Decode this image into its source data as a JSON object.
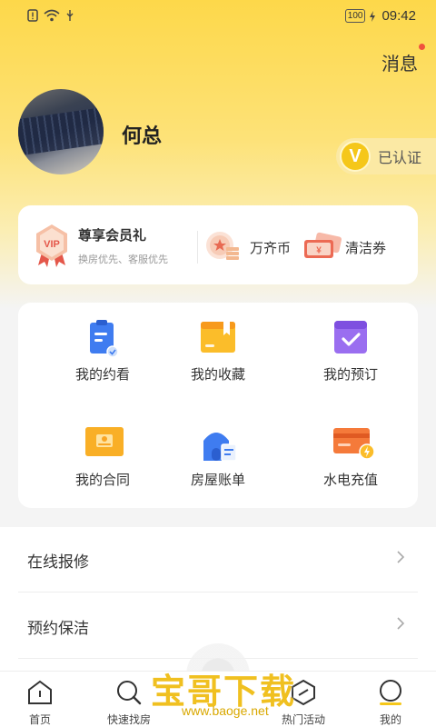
{
  "statusbar": {
    "battery": "100",
    "time": "09:42"
  },
  "header": {
    "messages_label": "消息",
    "user_name": "何总",
    "verified_badge": "V",
    "verified_label": "已认证"
  },
  "member": {
    "vip_text": "VIP",
    "title": "尊享会员礼",
    "subtitle": "换房优先、客服优先",
    "coins_label": "万齐币",
    "coupon_mark": "¥",
    "coupon_label": "清洁券"
  },
  "grid": [
    {
      "label": "我的约看",
      "icon": "appointment-icon"
    },
    {
      "label": "我的收藏",
      "icon": "favorites-icon"
    },
    {
      "label": "我的预订",
      "icon": "booking-icon"
    },
    {
      "label": "我的合同",
      "icon": "contract-icon"
    },
    {
      "label": "房屋账单",
      "icon": "bill-icon"
    },
    {
      "label": "水电充值",
      "icon": "recharge-icon"
    }
  ],
  "list": [
    {
      "label": "在线报修"
    },
    {
      "label": "预约保洁"
    }
  ],
  "tabs": [
    {
      "label": "首页"
    },
    {
      "label": "快速找房"
    },
    {
      "label": "热门活动"
    },
    {
      "label": "我的"
    }
  ],
  "watermark": {
    "text": "宝哥下载",
    "url": "www.baoge.net"
  },
  "colors": {
    "accent": "#f5c71a",
    "hero": "#fdd84a",
    "badge_dot": "#f0523d"
  }
}
